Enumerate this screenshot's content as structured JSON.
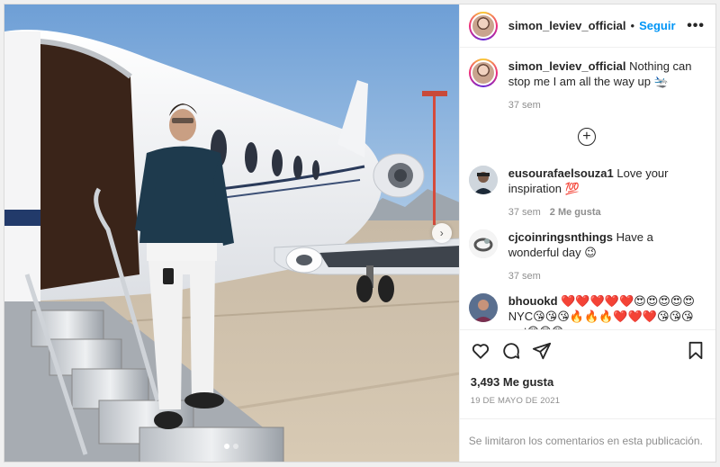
{
  "post": {
    "author": "simon_leviev_official",
    "separator": "•",
    "follow_label": "Seguir",
    "more_label": "•••",
    "caption": {
      "username": "simon_leviev_official",
      "text": "Nothing can stop me I am all the way up 🛬",
      "time": "37 sem"
    },
    "load_more_icon": "plus-circle-icon",
    "comments": [
      {
        "username": "eusourafaelsouza1",
        "text": "Love your inspiration 💯",
        "time": "37 sem",
        "likes": "2 Me gusta"
      },
      {
        "username": "cjcoinringsnthings",
        "text": "Have a wonderful day 😉",
        "time": "37 sem",
        "likes": ""
      },
      {
        "username": "bhouokd",
        "text": "❤️❤️❤️❤️❤️😍😍😍😍😍NYC😘😘😘🔥🔥🔥❤️❤️❤️😘😘😘mst😍😍😍",
        "time": "",
        "likes": ""
      }
    ],
    "likes_count": "3,493 Me gusta",
    "date": "19 DE MAYO DE 2021",
    "comments_limited": "Se limitaron los comentarios en esta publicación.",
    "carousel": {
      "slides": 2,
      "active": 0,
      "next_icon": "chevron-right-icon"
    }
  },
  "icons": {
    "like": "heart-icon",
    "comment": "comment-icon",
    "share": "paper-plane-icon",
    "save": "bookmark-icon"
  },
  "colors": {
    "follow": "#0095f6",
    "muted": "#8e8e8e",
    "text": "#262626",
    "border": "#dbdbdb"
  }
}
